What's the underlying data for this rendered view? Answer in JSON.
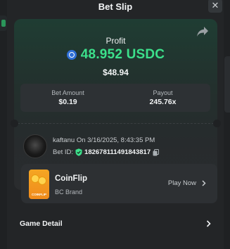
{
  "modal": {
    "title": "Bet Slip",
    "close_glyph": "✕"
  },
  "profit": {
    "label": "Profit",
    "value": "48.952 USDC",
    "fiat": "$48.94",
    "currency_icon": "usdc-icon"
  },
  "stats": {
    "bet_amount_label": "Bet Amount",
    "bet_amount_value": "$0.19",
    "payout_label": "Payout",
    "payout_value": "245.76x"
  },
  "bettor": {
    "name": "kaftanu",
    "on": "On",
    "datetime": "3/16/2025, 8:43:35 PM",
    "bet_id_label": "Bet ID:",
    "bet_id": "182678111491843817"
  },
  "game": {
    "name": "CoinFlip",
    "brand": "BC Brand",
    "thumb_text": "COINFLIP",
    "play_label": "Play Now"
  },
  "footer": {
    "game_detail_label": "Game Detail"
  },
  "colors": {
    "accent_green": "#3ce08b",
    "panel": "#232527",
    "card_top": "#1f3d33"
  }
}
